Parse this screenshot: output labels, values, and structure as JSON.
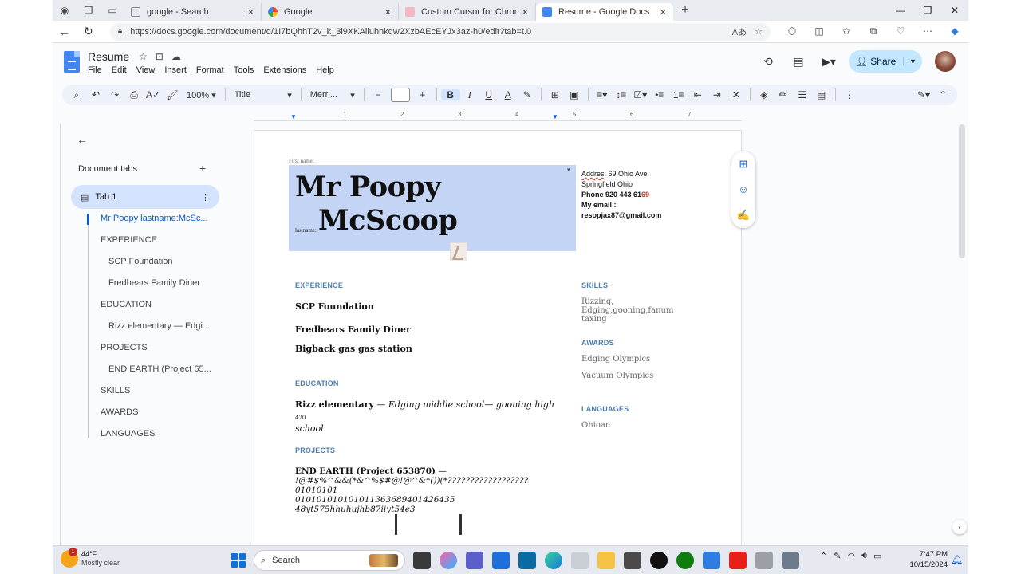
{
  "browser": {
    "tabs": [
      {
        "title": "google - Search",
        "favicon_color": "#ffffff"
      },
      {
        "title": "Google",
        "favicon_color": "#ffffff"
      },
      {
        "title": "Custom Cursor for Chrome™ - Cl",
        "favicon_color": "#f4b6c2"
      },
      {
        "title": "Resume - Google Docs",
        "favicon_color": "#4285f4"
      }
    ],
    "url": "https://docs.google.com/document/d/1I7bQhhT2v_k_3i9XKAiluhhkdw2XzbAEcEYJx3az-h0/edit?tab=t.0"
  },
  "docs": {
    "title": "Resume",
    "menu": [
      "File",
      "Edit",
      "View",
      "Insert",
      "Format",
      "Tools",
      "Extensions",
      "Help"
    ],
    "share_label": "Share",
    "toolbar": {
      "zoom": "100%",
      "style": "Title",
      "font": "Merri..."
    }
  },
  "ruler": {
    "marks": [
      "1",
      "2",
      "3",
      "4",
      "5",
      "6",
      "7"
    ]
  },
  "sidebar": {
    "heading": "Document tabs",
    "tab_name": "Tab 1",
    "outline": [
      {
        "label": "Mr Poopy lastname:McSc...",
        "level": 1
      },
      {
        "label": "EXPERIENCE",
        "level": 1
      },
      {
        "label": "SCP Foundation",
        "level": 2
      },
      {
        "label": "Fredbears Family Diner",
        "level": 2
      },
      {
        "label": "EDUCATION",
        "level": 1
      },
      {
        "label": "Rizz elementary — Edgi...",
        "level": 2
      },
      {
        "label": "PROJECTS",
        "level": 1
      },
      {
        "label": "END EARTH (Project 65...",
        "level": 2
      },
      {
        "label": "SKILLS",
        "level": 1
      },
      {
        "label": "AWARDS",
        "level": 1
      },
      {
        "label": "LANGUAGES",
        "level": 1
      }
    ]
  },
  "resume": {
    "first_name_label": "First name:",
    "first_name": "Mr Poopy",
    "last_name_label": "lastname:",
    "last_name": "McScoop",
    "contact": {
      "address_label": "Addres",
      "address_rest": ": 69 Ohio Ave",
      "city": "Springfield Ohio",
      "phone_prefix": "Phone 920 443 61",
      "phone_red": "69",
      "email_label": "My email :",
      "email": "resopjax87@gmail.com"
    },
    "experience_heading": "EXPERIENCE",
    "jobs": [
      "SCP Foundation",
      "Fredbears Family Diner",
      "Bigback gas gas station"
    ],
    "education_heading": "EDUCATION",
    "education": {
      "school1": "Rizz elementary",
      "dash1": "  — ",
      "rest": "Edging middle school— gooning high",
      "small": " 420",
      "tail": "school"
    },
    "projects_heading": "PROJECTS",
    "project": {
      "title": "END EARTH (Project  653870)",
      "dash": " —",
      "line2": "!@#$%^&&(*&^%$#@!@^&*())(*??????????????????01010101",
      "line3": "010101010101011363689401426435 48yt575hhuhujhb87iiyt54e3"
    },
    "skills_heading": "SKILLS",
    "skills_text": "Rizzing, Edging,gooning,fanum taxing",
    "awards_heading": "AWARDS",
    "awards": [
      "Edging Olympics",
      "Vacuum Olympics"
    ],
    "languages_heading": "LANGUAGES",
    "languages": [
      "Ohioan"
    ]
  },
  "taskbar": {
    "weather_temp": "44°F",
    "weather_desc": "Mostly clear",
    "weather_badge": "1",
    "search_placeholder": "Search",
    "time": "7:47 PM",
    "date": "10/15/2024"
  }
}
